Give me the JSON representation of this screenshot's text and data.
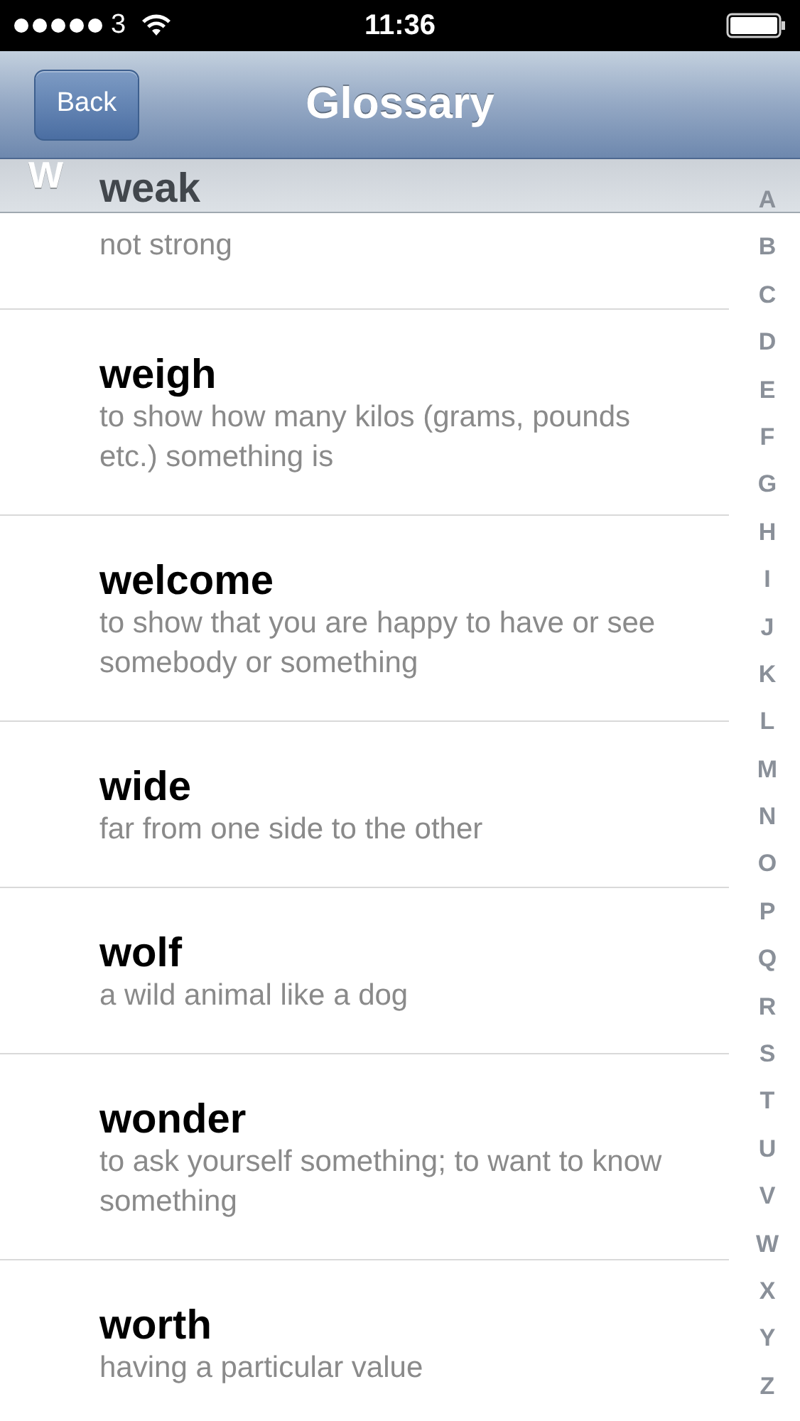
{
  "status_bar": {
    "carrier": "3",
    "time": "11:36"
  },
  "nav": {
    "back": "Back",
    "title": "Glossary"
  },
  "section": {
    "letter": "W"
  },
  "entries": [
    {
      "word": "weak",
      "definition": "not strong"
    },
    {
      "word": "weigh",
      "definition": "to show how many kilos (grams, pounds etc.) something is"
    },
    {
      "word": "welcome",
      "definition": "to show that you are happy to have or see somebody or something"
    },
    {
      "word": "wide",
      "definition": "far from one side to the other"
    },
    {
      "word": "wolf",
      "definition": "a wild animal like a dog"
    },
    {
      "word": "wonder",
      "definition": "to ask yourself something; to want to know something"
    },
    {
      "word": "worth",
      "definition": "having a particular value"
    }
  ],
  "index": [
    "A",
    "B",
    "C",
    "D",
    "E",
    "F",
    "G",
    "H",
    "I",
    "J",
    "K",
    "L",
    "M",
    "N",
    "O",
    "P",
    "Q",
    "R",
    "S",
    "T",
    "U",
    "V",
    "W",
    "X",
    "Y",
    "Z"
  ]
}
